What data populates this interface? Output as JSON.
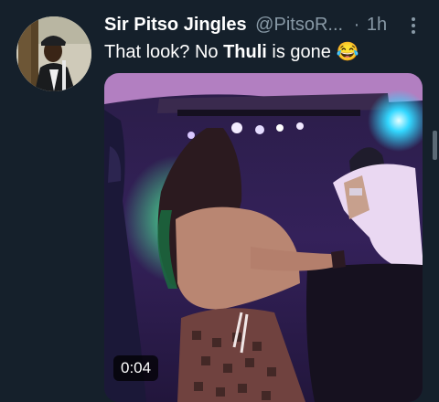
{
  "tweet": {
    "display_name": "Sir Pitso Jingles",
    "handle": "@PitsoR...",
    "separator": "·",
    "time": "1h",
    "text_before": "That look? No ",
    "text_bold": "Thuli",
    "text_after": " is gone 😂",
    "avatar_icon": "profile-photo",
    "more_icon": "more-vertical-icon"
  },
  "media": {
    "duration": "0:04",
    "kind": "video"
  },
  "colors": {
    "background": "#15202b",
    "secondary_text": "#8899a6"
  }
}
